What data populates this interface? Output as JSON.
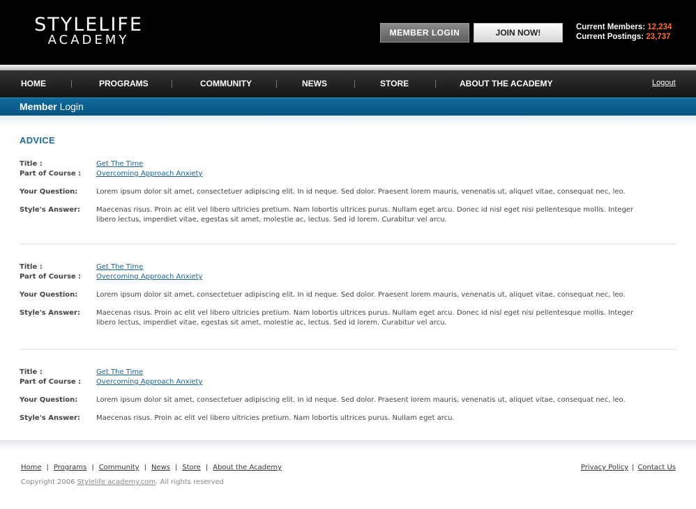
{
  "header": {
    "logo_line1": "STYLELIFE",
    "logo_line2": "ACADEMY",
    "member_login_label": "MEMBER LOGIN",
    "join_label": "JOIN NOW!",
    "members_label": "Current Members:",
    "members_value": "12,234",
    "postings_label": "Current Postings:",
    "postings_value": "23,737",
    "accent_color": "#ff6a2b"
  },
  "nav": {
    "items": [
      {
        "label": "HOME"
      },
      {
        "label": "PROGRAMS"
      },
      {
        "label": "COMMUNITY"
      },
      {
        "label": "NEWS"
      },
      {
        "label": "STORE"
      },
      {
        "label": "ABOUT THE ACADEMY"
      }
    ],
    "logout_label": "Logout"
  },
  "subheader": {
    "bold": "Member",
    "rest": "Login",
    "color": "#0f6a9c"
  },
  "section_title": "ADVICE",
  "labels": {
    "title": "Title :",
    "course": "Part of Course :",
    "question": "Your Question:",
    "answer": "Style's Answer:"
  },
  "entries": [
    {
      "title": "Get The Time",
      "course": "Overcoming Approach Anxiety",
      "question": "Lorem ipsum dolor sit amet, consectetuer adipiscing elit. In id neque. Sed dolor. Praesent lorem mauris, venenatis ut, aliquet vitae, consequat nec, leo.",
      "answer": "Maecenas risus. Proin ac elit vel libero ultricies pretium. Nam lobortis ultrices purus. Nullam eget arcu. Donec id nisl eget nisi pellentesque mollis. Integer libero lectus, imperdiet vitae, egestas sit amet, molestie ac, lectus. Sed id lorem. Curabitur vel arcu."
    },
    {
      "title": "Get The Time",
      "course": "Overcoming Approach Anxiety",
      "question": "Lorem ipsum dolor sit amet, consectetuer adipiscing elit. In id neque. Sed dolor. Praesent lorem mauris, venenatis ut, aliquet vitae, consequat nec, leo.",
      "answer": "Maecenas risus. Proin ac elit vel libero ultricies pretium. Nam lobortis ultrices purus. Nullam eget arcu. Donec id nisl eget nisi pellentesque mollis. Integer libero lectus, imperdiet vitae, egestas sit amet, molestie ac, lectus. Sed id lorem. Curabitur vel arcu."
    },
    {
      "title": "Get The Time",
      "course": "Overcoming Approach Anxiety",
      "question": "Lorem ipsum dolor sit amet, consectetuer adipiscing elit. In id neque. Sed dolor. Praesent lorem mauris, venenatis ut, aliquet vitae, consequat nec, leo.",
      "answer": "Maecenas risus. Proin ac elit vel libero ultricies pretium. Nam lobortis ultrices purus. Nullam eget arcu."
    }
  ],
  "footer": {
    "links": [
      {
        "label": "Home"
      },
      {
        "label": "Programs"
      },
      {
        "label": "Community"
      },
      {
        "label": "News"
      },
      {
        "label": "Store"
      },
      {
        "label": "About the Academy"
      }
    ],
    "privacy_label": "Privacy Policy",
    "contact_label": "Contact Us",
    "copyright_prefix": "Copyright 2006",
    "copyright_link": "Stylelife academy.com",
    "copyright_suffix": ".  All rights reserved"
  }
}
